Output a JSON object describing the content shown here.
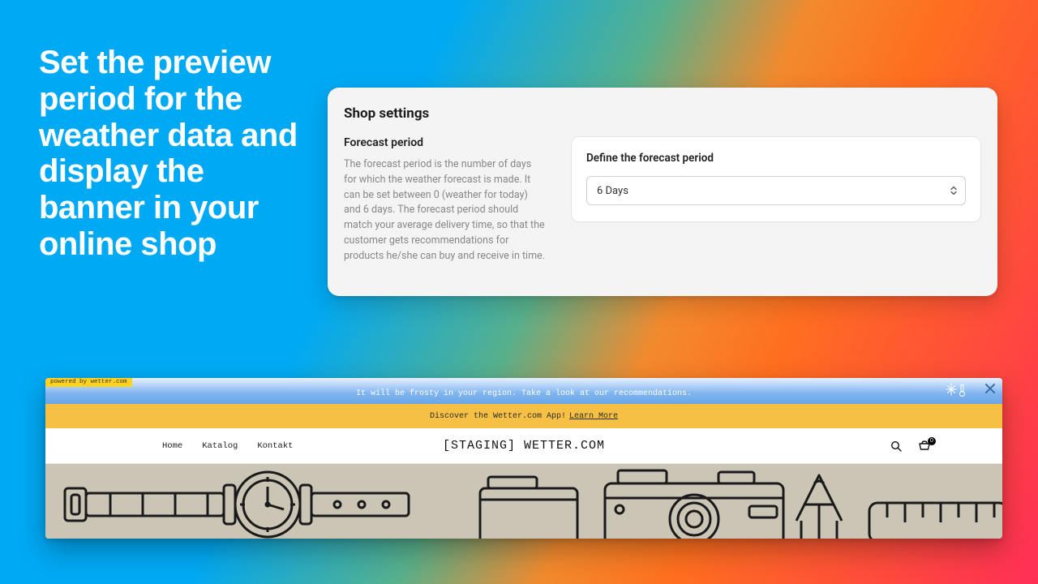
{
  "headline": "Set the preview period for the weather data and display the banner in your online shop",
  "card": {
    "title": "Shop settings",
    "forecast_label": "Forecast period",
    "forecast_desc": "The forecast period is the number of days for which the weather forecast is made. It can be set between 0 (weather for today) and 6 days. The forecast period should match your average delivery time, so that the customer gets recommendations for products he/she can buy and receive in time.",
    "define_label": "Define the forecast period",
    "select_value": "6 Days"
  },
  "preview": {
    "powered": "powered by wetter.com",
    "weather_msg": "It will be frosty in your region. Take a look at our recommendations.",
    "promo_text": "Discover the Wetter.com App!",
    "promo_link": "Learn More",
    "nav": {
      "home": "Home",
      "katalog": "Katalog",
      "kontakt": "Kontakt"
    },
    "brand": "[STAGING] WETTER.COM",
    "cart_count": "0"
  }
}
